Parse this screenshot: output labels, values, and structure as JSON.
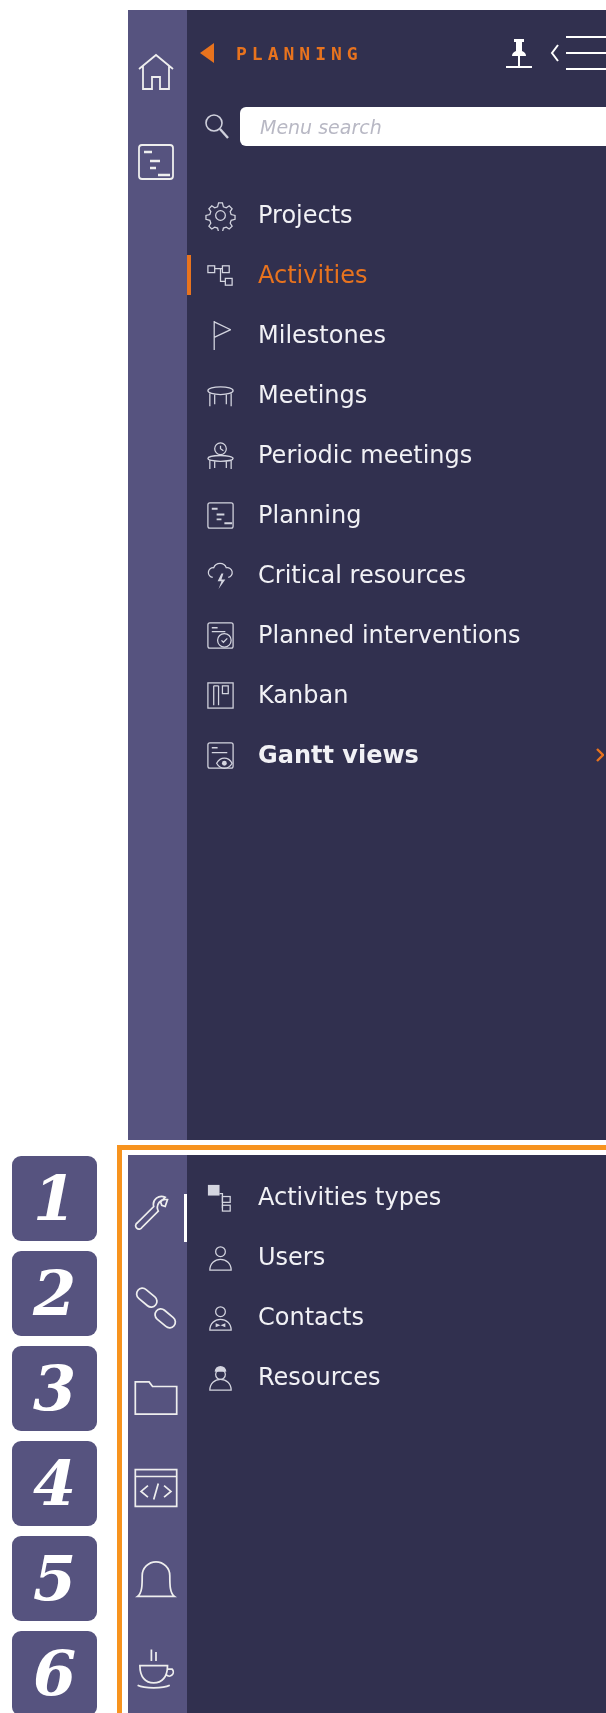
{
  "header": {
    "title": "PLANNING"
  },
  "search": {
    "placeholder": "Menu search"
  },
  "top_rail": [
    {
      "selected": false
    },
    {
      "selected": false
    }
  ],
  "menu": [
    {
      "label": "Projects",
      "selected": false,
      "kind": "link"
    },
    {
      "label": "Activities",
      "selected": true,
      "kind": "link"
    },
    {
      "label": "Milestones",
      "selected": false,
      "kind": "link"
    },
    {
      "label": "Meetings",
      "selected": false,
      "kind": "link"
    },
    {
      "label": "Periodic meetings",
      "selected": false,
      "kind": "link"
    },
    {
      "label": "Planning",
      "selected": false,
      "kind": "link"
    },
    {
      "label": "Critical resources",
      "selected": false,
      "kind": "link"
    },
    {
      "label": "Planned interventions",
      "selected": false,
      "kind": "link"
    },
    {
      "label": "Kanban",
      "selected": false,
      "kind": "link"
    },
    {
      "label": "Gantt views",
      "selected": false,
      "kind": "group"
    }
  ],
  "badges": [
    "1",
    "2",
    "3",
    "4",
    "5",
    "6"
  ],
  "bottom_rail": [
    {
      "selected": true
    },
    {
      "selected": false
    },
    {
      "selected": false
    },
    {
      "selected": false
    },
    {
      "selected": false
    },
    {
      "selected": false
    }
  ],
  "bottom_menu": [
    {
      "label": "Activities types",
      "selected": false
    },
    {
      "label": "Users",
      "selected": false
    },
    {
      "label": "Contacts",
      "selected": false
    },
    {
      "label": "Resources",
      "selected": false
    }
  ]
}
